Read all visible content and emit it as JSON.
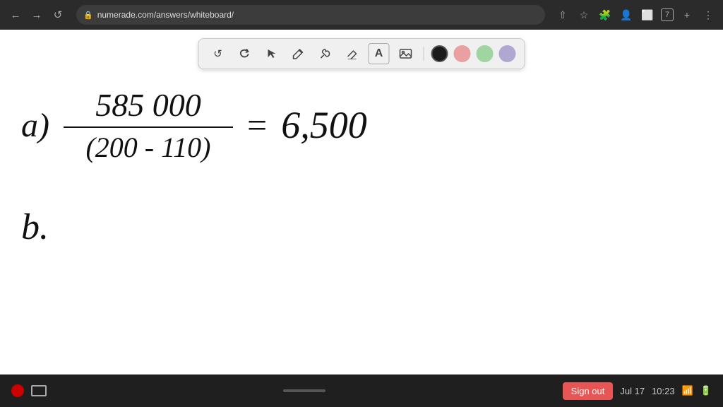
{
  "browser": {
    "url": "numerade.com/answers/whiteboard/",
    "back_label": "←",
    "forward_label": "→",
    "reload_label": "↺",
    "share_label": "⇧",
    "star_label": "☆",
    "extensions_label": "🧩",
    "user_label": "👤",
    "window_label": "⬜",
    "tab_number": "7",
    "more_label": "⋮"
  },
  "toolbar": {
    "undo_label": "↺",
    "redo_label": "↻",
    "select_label": "↖",
    "pen_label": "✏",
    "tools_label": "✱",
    "eraser_label": "/",
    "text_label": "A",
    "image_label": "🖼",
    "colors": [
      {
        "name": "black",
        "hex": "#1a1a1a",
        "active": true
      },
      {
        "name": "pink",
        "hex": "#e8a0a0"
      },
      {
        "name": "green",
        "hex": "#a0d4a0"
      },
      {
        "name": "purple",
        "hex": "#b0a8d0"
      }
    ]
  },
  "whiteboard": {
    "problem_a_label": "a)",
    "numerator": "585 000",
    "denominator": "(200 - 110)",
    "equals": "=",
    "result": "6,500",
    "problem_b_label": "b."
  },
  "status_bar": {
    "sign_out_label": "Sign out",
    "date": "Jul 17",
    "time": "10:23"
  }
}
